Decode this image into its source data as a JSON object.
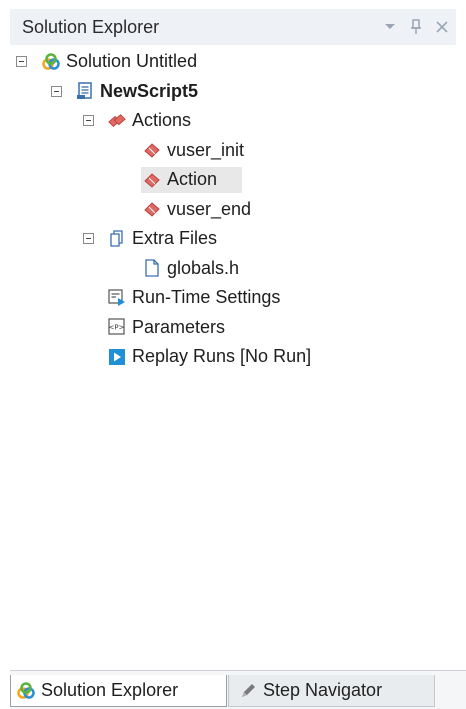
{
  "header": {
    "title": "Solution Explorer",
    "controls": [
      "dropdown-arrow-icon",
      "pin-icon",
      "close-icon"
    ]
  },
  "tree": {
    "solution": {
      "label": "Solution Untitled",
      "icon": "solution-icon"
    },
    "script": {
      "label": "NewScript5",
      "icon": "script-icon"
    },
    "actions": {
      "label": "Actions",
      "icon": "actions-folder-icon",
      "children": [
        {
          "label": "vuser_init",
          "icon": "action-icon"
        },
        {
          "label": "Action",
          "icon": "action-icon",
          "selected": true
        },
        {
          "label": "vuser_end",
          "icon": "action-icon"
        }
      ]
    },
    "extra_files": {
      "label": "Extra Files",
      "icon": "extra-files-icon",
      "children": [
        {
          "label": "globals.h",
          "icon": "file-icon"
        }
      ]
    },
    "runtime_settings": {
      "label": "Run-Time Settings",
      "icon": "runtime-settings-icon"
    },
    "parameters": {
      "label": "Parameters",
      "icon": "parameters-icon"
    },
    "replay_runs": {
      "label": "Replay Runs [No Run]",
      "icon": "replay-runs-icon"
    }
  },
  "bottom_tabs": [
    {
      "label": "Solution Explorer",
      "icon": "solution-icon",
      "active": true
    },
    {
      "label": "Step Navigator",
      "icon": "step-navigator-icon",
      "active": false
    }
  ],
  "colors": {
    "header_bg": "#eef1f6",
    "selection_bg": "#e8e8e8",
    "action_red": "#d9534f",
    "replay_blue": "#1f8fd6"
  }
}
